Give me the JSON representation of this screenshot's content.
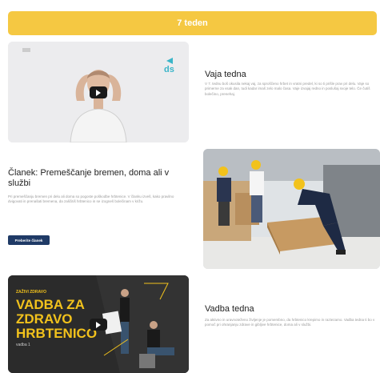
{
  "banner": {
    "label": "7 teden"
  },
  "cards": [
    {
      "title": "Vaja tedna",
      "description": "V 7. tednu boš okusila nekaj vaj, za sproščeno hrbet in vratni predel, ki so ti prišle prav pri delu. Vaje so primerne za vsak dan, tudi kadar imaš zelo malo časa. Vaje izvajaj redno in poslušaj svoje telo. Če čutiš bolečino, prenehaj.",
      "video_badge": "ds"
    },
    {
      "title": "Članek: Premeščanje bremen, doma ali v službi",
      "description": "Pri premeščanju bremen pri delu ali doma so pogoste poškodbe hrbtenice. V članku izveš, kako pravilno dvigovati in prenašati bremena, da zaščitiš hrbtenico in se izogneš bolečinam v križu.",
      "button_label": "Preberite članek"
    },
    {
      "title": "Vadba tedna",
      "description": "Za aktivno in uravnoteženo življenje je pomembno, da hrbtenico krepimo in raztezamo. Vadba tedna ti bo v pomoč pri ohranjanju zdrave in gibljive hrbtenice, doma ali v službi.",
      "video_title_lines": [
        "VADBA ZA",
        "ZDRAVO",
        "HRBTENICO"
      ],
      "video_kicker": "ZAŽIVI ZDRAVO",
      "video_sub": "vadba 1"
    }
  ],
  "colors": {
    "accent_yellow": "#f5c842",
    "button_navy": "#1f3a66"
  }
}
